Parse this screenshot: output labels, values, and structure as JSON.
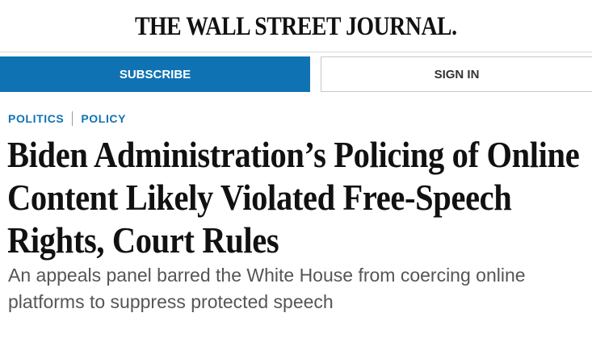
{
  "masthead": {
    "logo_text": "THE WALL STREET JOURNAL."
  },
  "auth": {
    "subscribe_label": "SUBSCRIBE",
    "signin_label": "SIGN IN"
  },
  "breadcrumb": {
    "items": [
      {
        "label": "POLITICS"
      },
      {
        "label": "POLICY"
      }
    ]
  },
  "article": {
    "headline": "Biden Administration’s Policing of Online Content Likely Violated Free-Speech Rights, Court Rules",
    "dek": "An appeals panel barred the White House from coercing online platforms to suppress protected speech"
  },
  "colors": {
    "accent": "#0f73b3",
    "text": "#111111",
    "dek": "#555555"
  }
}
